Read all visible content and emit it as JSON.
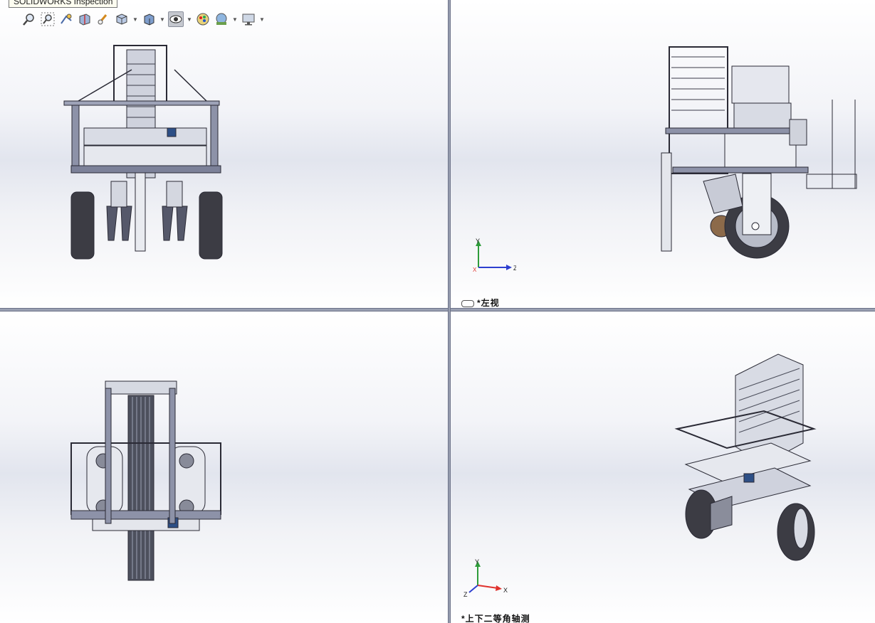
{
  "tooltip": "SOLIDWORKS Inspection",
  "toolbar": {
    "icons": [
      "zoom-to-fit-icon",
      "zoom-area-icon",
      "previous-view-icon",
      "section-view-icon",
      "dynamic-annotation-icon",
      "view-orientation-icon",
      "display-style-icon",
      "hide-show-items-icon",
      "edit-appearance-icon",
      "apply-scene-icon",
      "view-settings-icon"
    ]
  },
  "viewports": {
    "top_left": {
      "label": ""
    },
    "top_right": {
      "label": "*左视"
    },
    "bottom_left": {
      "label": ""
    },
    "bottom_right": {
      "label": "*上下二等角轴测"
    }
  },
  "triad": {
    "x": "X",
    "y": "Y",
    "z": "Z"
  },
  "colors": {
    "frame": "#6a6d88",
    "accent_blue": "#2d4f86",
    "axis_x": "#e0322d",
    "axis_y": "#2e9c3a",
    "axis_z": "#2d3fd0"
  }
}
